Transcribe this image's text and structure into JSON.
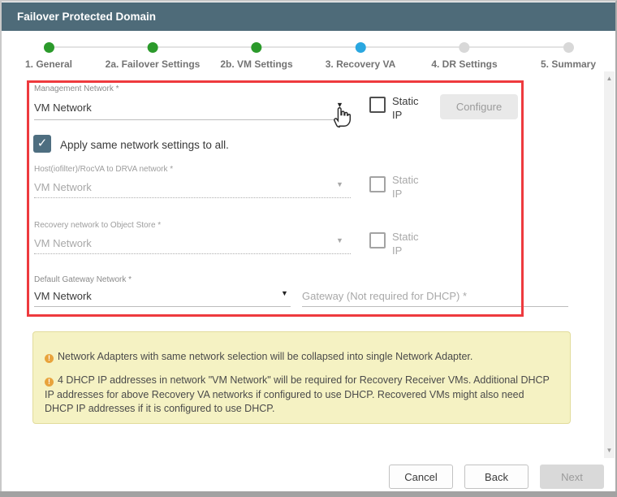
{
  "window": {
    "title": "Failover Protected Domain"
  },
  "stepper": {
    "steps": [
      {
        "label": "1. General",
        "state": "completed"
      },
      {
        "label": "2a. Failover Settings",
        "state": "completed"
      },
      {
        "label": "2b. VM Settings",
        "state": "completed"
      },
      {
        "label": "3. Recovery VA",
        "state": "current"
      },
      {
        "label": "4. DR Settings",
        "state": "upcoming"
      },
      {
        "label": "5. Summary",
        "state": "upcoming"
      }
    ]
  },
  "form": {
    "management_network": {
      "label": "Management Network *",
      "value": "VM Network",
      "static_ip_label": "Static IP",
      "configure_label": "Configure"
    },
    "apply_all_label": "Apply same network settings to all.",
    "host_network": {
      "label": "Host(iofilter)/RocVA to DRVA network *",
      "value": "VM Network",
      "static_ip_label": "Static IP"
    },
    "recovery_network": {
      "label": "Recovery network to Object Store *",
      "value": "VM Network",
      "static_ip_label": "Static IP"
    },
    "gateway_network": {
      "label": "Default Gateway Network *",
      "value": "VM Network",
      "gateway_placeholder": "Gateway (Not required for DHCP) *"
    }
  },
  "notices": [
    {
      "text": "Network Adapters with same network selection will be collapsed into single Network Adapter."
    },
    {
      "text": "4 DHCP IP addresses in network \"VM Network\" will be required for Recovery Receiver VMs. Additional DHCP IP addresses for above Recovery VA networks if configured to use DHCP. Recovered VMs might also need DHCP IP addresses if it is configured to use DHCP."
    }
  ],
  "footer": {
    "cancel_label": "Cancel",
    "back_label": "Back",
    "next_label": "Next"
  },
  "colors": {
    "header_bg": "#4e6b79",
    "step_completed": "#2b9a2b",
    "step_current": "#2aa7e0",
    "step_upcoming": "#d8d8d8",
    "highlight_border": "#ee3a3e",
    "notice_bg": "#f5f2c3",
    "notice_icon": "#e8a33c",
    "checkbox_checked": "#4e6e80"
  }
}
